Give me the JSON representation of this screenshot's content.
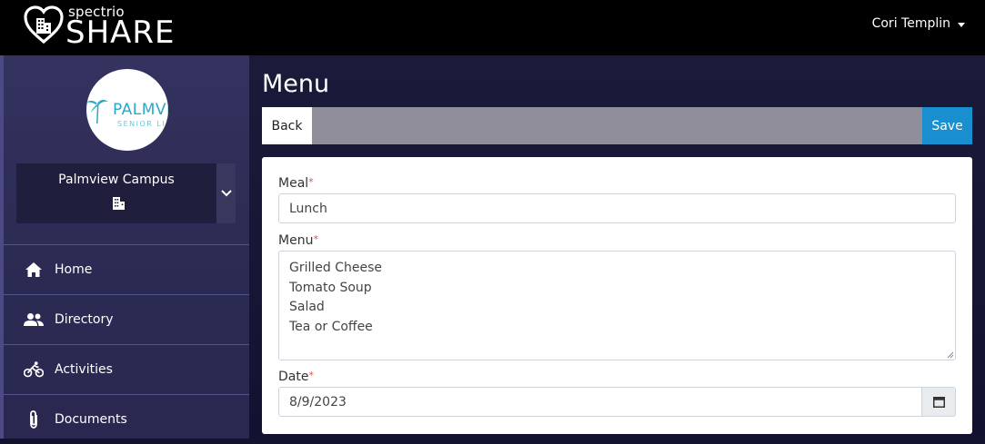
{
  "header": {
    "brand_small": "spectrio",
    "brand_big": "SHARE",
    "user_name": "Cori Templin"
  },
  "sidebar": {
    "logo_text": "PALMVI",
    "logo_sub": "SENIOR LI",
    "campus_name": "Palmview Campus",
    "nav": [
      {
        "label": "Home",
        "icon": "home-icon"
      },
      {
        "label": "Directory",
        "icon": "people-icon"
      },
      {
        "label": "Activities",
        "icon": "bicycle-icon"
      },
      {
        "label": "Documents",
        "icon": "paperclip-icon"
      }
    ]
  },
  "main": {
    "title": "Menu",
    "back_label": "Back",
    "save_label": "Save",
    "form": {
      "meal_label": "Meal",
      "meal_value": "Lunch",
      "menu_label": "Menu",
      "menu_value": "Grilled Cheese\nTomato Soup\nSalad\nTea or Coffee",
      "date_label": "Date",
      "date_value": "8/9/2023",
      "required_mark": "*"
    }
  },
  "colors": {
    "accent": "#1a8fd0",
    "topbar": "#000000",
    "sidebar": "#2b2a52",
    "required": "#d9534f"
  }
}
